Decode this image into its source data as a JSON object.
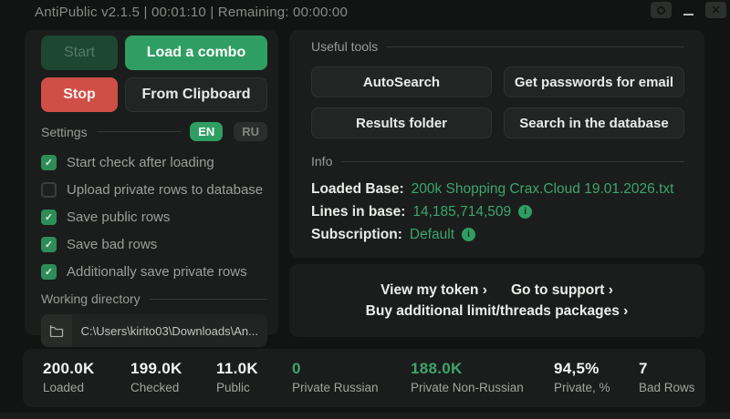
{
  "titlebar": {
    "title": "AntiPublic v2.1.5 | 00:01:10 | Remaining: 00:00:00",
    "close_glyph": "✕"
  },
  "left_panel": {
    "buttons": {
      "start": "Start",
      "load_combo": "Load a combo",
      "stop": "Stop",
      "from_clipboard": "From Clipboard"
    },
    "settings": {
      "label": "Settings",
      "lang_en": "EN",
      "lang_ru": "RU"
    },
    "checkboxes": [
      {
        "label": "Start check after loading",
        "checked": true
      },
      {
        "label": "Upload private rows to database",
        "checked": false
      },
      {
        "label": "Save public rows",
        "checked": true
      },
      {
        "label": "Save bad rows",
        "checked": true
      },
      {
        "label": "Additionally save private rows",
        "checked": true
      }
    ],
    "working_directory": {
      "label": "Working directory",
      "path": "C:\\Users\\kirito03\\Downloads\\An..."
    }
  },
  "tools_panel": {
    "header": "Useful tools",
    "buttons": [
      "AutoSearch",
      "Get passwords for email",
      "Results folder",
      "Search in the database"
    ]
  },
  "info_panel": {
    "header": "Info",
    "rows": [
      {
        "label": "Loaded Base:",
        "value": "200k Shopping Crax.Cloud 19.01.2026.txt",
        "info_icon": false
      },
      {
        "label": "Lines in base:",
        "value": "14,185,714,509",
        "info_icon": true
      },
      {
        "label": "Subscription:",
        "value": "Default",
        "info_icon": true
      }
    ],
    "info_icon_glyph": "i"
  },
  "links_panel": {
    "view_token": "View my token ›",
    "support": "Go to support ›",
    "buy_packages": "Buy additional limit/threads packages ›"
  },
  "stats": [
    {
      "value": "200.0K",
      "label": "Loaded",
      "green": false
    },
    {
      "value": "199.0K",
      "label": "Checked",
      "green": false
    },
    {
      "value": "11.0K",
      "label": "Public",
      "green": false
    },
    {
      "value": "0",
      "label": "Private Russian",
      "green": true
    },
    {
      "value": "188.0K",
      "label": "Private Non-Russian",
      "green": true
    },
    {
      "value": "94,5%",
      "label": "Private, %",
      "green": false
    },
    {
      "value": "7",
      "label": "Bad Rows",
      "green": false
    }
  ],
  "colors": {
    "accent_green": "#2f9e63",
    "text_green": "#3da46e",
    "stop_red": "#cf4e46",
    "card_bg": "#1a1d1b",
    "page_bg": "#121413"
  }
}
